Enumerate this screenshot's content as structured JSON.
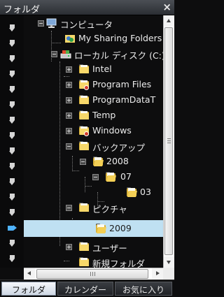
{
  "window": {
    "title": "フォルダ",
    "close_label": "×"
  },
  "tree": {
    "items": [
      {
        "label": "コンピュータ",
        "icon": "computer-icon",
        "expanded": true
      },
      {
        "label": "My Sharing Folders",
        "icon": "shared-folder-icon"
      },
      {
        "label": "ローカル ディスク (C:)",
        "icon": "drive-icon",
        "expanded": true
      },
      {
        "label": "Intel",
        "icon": "folder-icon"
      },
      {
        "label": "Program Files",
        "icon": "folder-restricted-icon"
      },
      {
        "label": "ProgramDataT",
        "icon": "folder-icon"
      },
      {
        "label": "Temp",
        "icon": "folder-icon"
      },
      {
        "label": "Windows",
        "icon": "folder-restricted-icon"
      },
      {
        "label": "バックアップ",
        "icon": "folder-icon",
        "expanded": true
      },
      {
        "label": "2008",
        "icon": "folder-icon",
        "expanded": true
      },
      {
        "label": "07",
        "icon": "folder-icon",
        "expanded": true
      },
      {
        "label": "03",
        "icon": "folder-open-icon"
      },
      {
        "label": "ピクチャ",
        "icon": "folder-icon",
        "expanded": true
      },
      {
        "label": "2009",
        "icon": "folder-open-icon",
        "selected": true
      },
      {
        "label": "ユーザー",
        "icon": "folder-icon"
      },
      {
        "label": "新規フォルダ",
        "icon": "folder-icon"
      }
    ]
  },
  "tabs": [
    {
      "label": "フォルダ",
      "active": true
    },
    {
      "label": "カレンダー"
    },
    {
      "label": "お気に入り"
    }
  ],
  "colors": {
    "selection": "#bfe0f2",
    "active_marker": "#4fb3ff",
    "folder": "#f7d86a"
  }
}
